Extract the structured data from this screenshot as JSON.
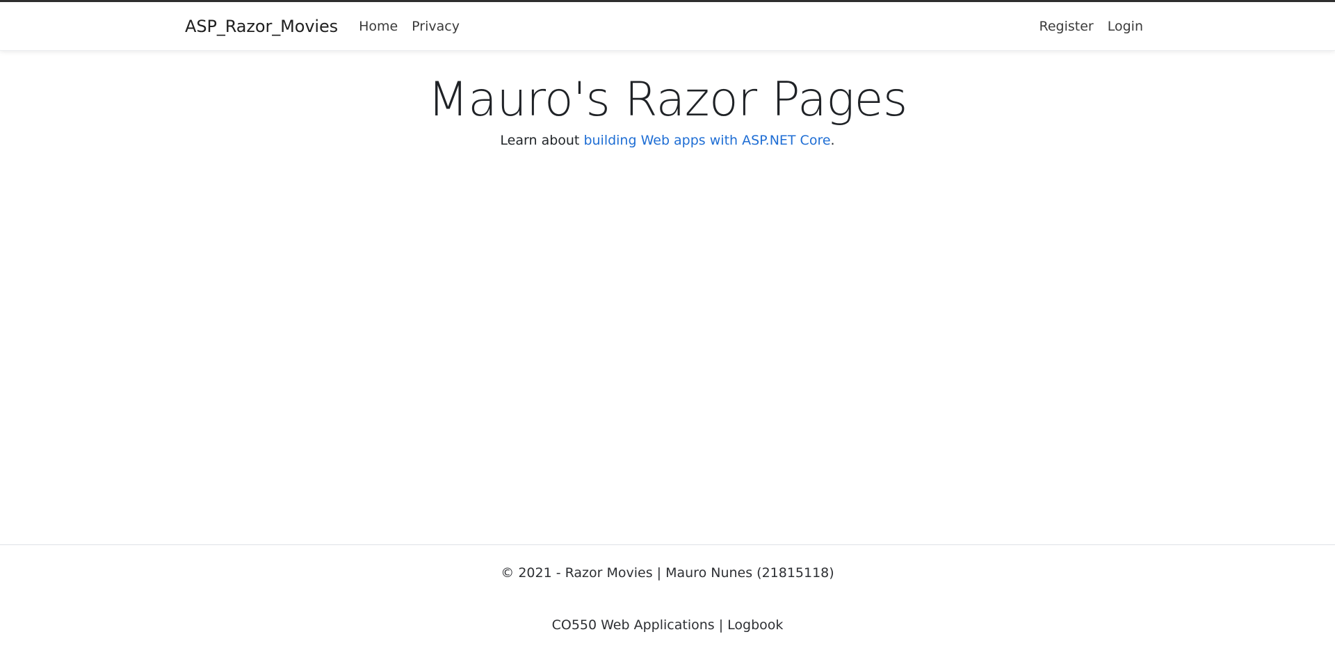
{
  "navbar": {
    "brand": "ASP_Razor_Movies",
    "left_links": [
      "Home",
      "Privacy"
    ],
    "right_links": [
      "Register",
      "Login"
    ]
  },
  "hero": {
    "title": "Mauro's Razor Pages",
    "subtitle_prefix": "Learn about ",
    "subtitle_link": "building Web apps with ASP.NET Core",
    "subtitle_suffix": "."
  },
  "footer": {
    "line1": "© 2021 - Razor Movies | Mauro Nunes (21815118)",
    "line2": "CO550 Web Applications | Logbook"
  },
  "colors": {
    "link": "#1f6ed4",
    "text": "#212529",
    "topline": "#2f2f2f"
  }
}
